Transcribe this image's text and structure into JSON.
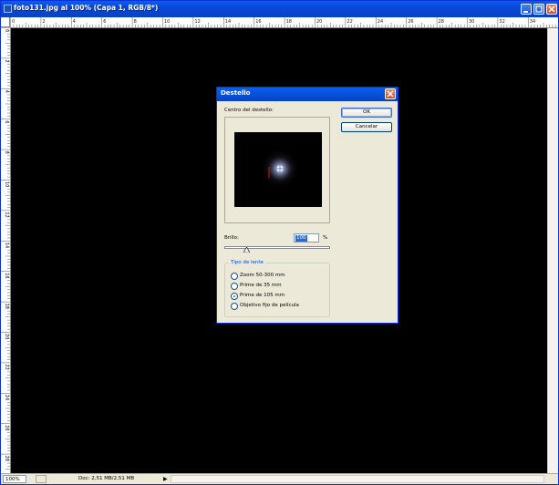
{
  "window": {
    "title": "foto131.jpg al 100% (Capa 1, RGB/8*)"
  },
  "ruler_top_labels": [
    "0",
    "2",
    "4",
    "6",
    "8",
    "10",
    "12",
    "14",
    "16",
    "18",
    "20",
    "22",
    "24",
    "26",
    "28",
    "30",
    "32",
    "34"
  ],
  "ruler_left_labels": [
    "0",
    "2",
    "4",
    "6",
    "8",
    "10",
    "12",
    "14",
    "16",
    "18",
    "20",
    "22",
    "24",
    "26",
    "28"
  ],
  "status": {
    "zoom": "100%",
    "doc": "Doc: 2,51 MB/2,51 MB"
  },
  "dialog": {
    "title": "Destello",
    "center_label": "Centro del destello:",
    "ok_label": "OK",
    "cancel_label": "Cancelar",
    "brillo_label": "Brillo:",
    "brillo_value": "100",
    "percent": "%",
    "lens_group_title": "Tipo de lente",
    "lens_options": [
      {
        "label": "Zoom 50-300 mm",
        "selected": false
      },
      {
        "label": "Prime de 35 mm",
        "selected": false
      },
      {
        "label": "Prime de 105 mm",
        "selected": true
      },
      {
        "label": "Objetivo fijo de película",
        "selected": false
      }
    ]
  },
  "colors": {
    "titlebar": "#0a46d8",
    "canvas": "#000000",
    "dialog_bg": "#ece9d8"
  }
}
